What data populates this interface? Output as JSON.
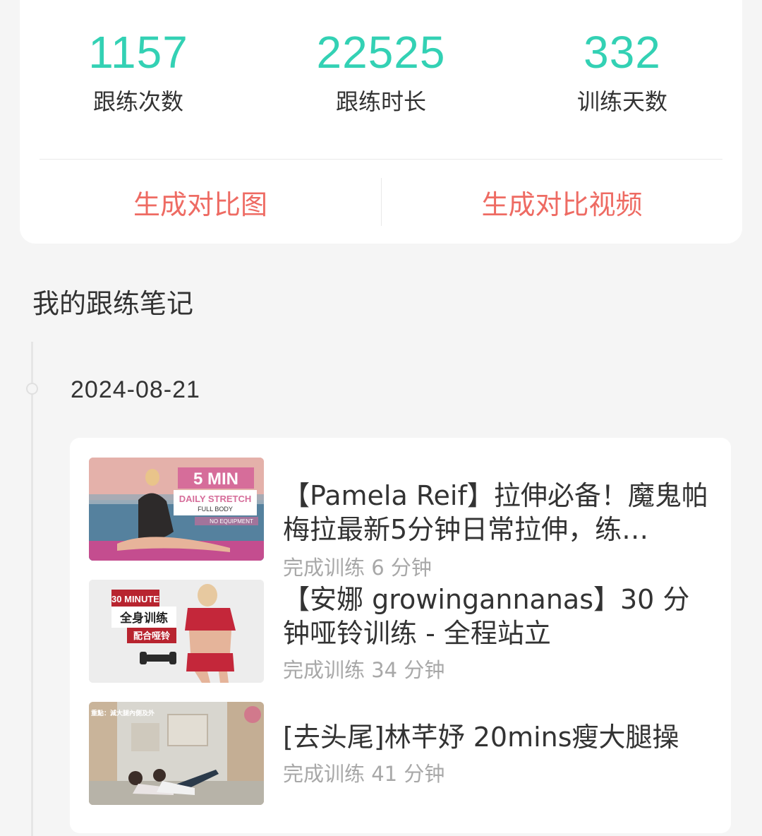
{
  "stats": [
    {
      "value": "1157",
      "label": "跟练次数"
    },
    {
      "value": "22525",
      "label": "跟练时长"
    },
    {
      "value": "332",
      "label": "训练天数"
    }
  ],
  "actions": {
    "compare_image": "生成对比图",
    "compare_video": "生成对比视频"
  },
  "section_title": "我的跟练笔记",
  "timeline": {
    "date": "2024-08-21"
  },
  "notes": [
    {
      "title": "【Pamela Reif】拉伸必备！魔鬼帕梅拉最新5分钟日常拉伸，练…",
      "subtitle": "完成训练 6 分钟",
      "thumb_text": {
        "badge": "5 MIN",
        "line1": "DAILY STRETCH",
        "line2": "FULL BODY",
        "line3": "NO EQUIPMENT"
      }
    },
    {
      "title": "【安娜 growingannanas】30 分钟哑铃训练 - 全程站立",
      "subtitle": "完成训练 34 分钟",
      "thumb_text": {
        "badge": "30 MINUTE",
        "line1": "全身训练",
        "line2": "配合哑铃"
      }
    },
    {
      "title": "[去头尾]林芊妤 20mins瘦大腿操",
      "subtitle": "完成训练 41 分钟",
      "thumb_text": {
        "line1": "重點：減大腿內側及外"
      }
    }
  ],
  "colors": {
    "accent": "#33d1b4",
    "action": "#ee6b63",
    "background": "#f5f5f5",
    "card": "#ffffff"
  }
}
